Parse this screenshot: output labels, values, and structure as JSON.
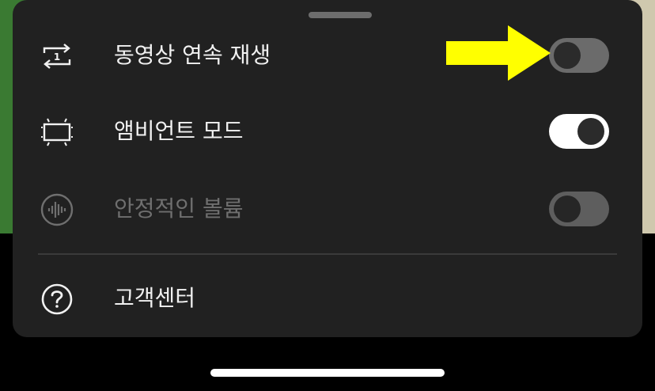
{
  "settings": {
    "autoplay": {
      "label": "동영상 연속 재생",
      "enabled": false
    },
    "ambient": {
      "label": "앰비언트 모드",
      "enabled": true
    },
    "stable_volume": {
      "label": "안정적인 볼륨",
      "enabled": false,
      "disabled": true
    },
    "help": {
      "label": "고객센터"
    }
  },
  "icons": {
    "autoplay": "repeat-one-icon",
    "ambient": "ambient-mode-icon",
    "stable_volume": "waveform-icon",
    "help": "help-circle-icon"
  },
  "colors": {
    "sheet_background": "#212121",
    "toggle_on_track": "#ffffff",
    "toggle_off_track": "#6b6b6b",
    "annotation_arrow": "#ffff00"
  }
}
